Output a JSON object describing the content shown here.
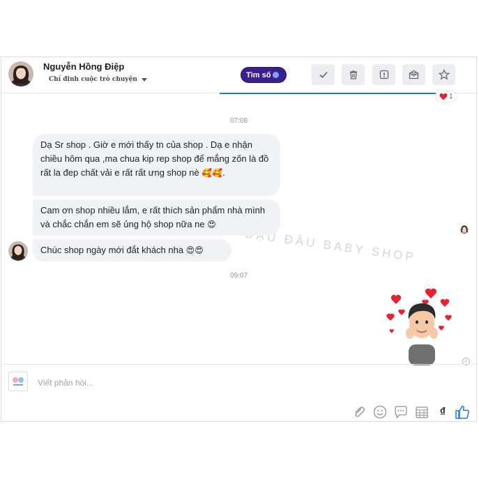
{
  "header": {
    "contact_name": "Nguyễn Hồng Điệp",
    "assign_label": "Chỉ định cuộc trò chuyện",
    "find_button": "Tìm số",
    "tools": [
      {
        "icon": "check-icon"
      },
      {
        "icon": "trash-icon"
      },
      {
        "icon": "report-icon"
      },
      {
        "icon": "mark-unread-icon"
      },
      {
        "icon": "star-icon"
      }
    ],
    "reaction_count": "1"
  },
  "conversation": {
    "time1": "07:08",
    "messages": [
      {
        "text": "Dạ Sr shop . Giờ e mới thấy tn của shop . Dạ e nhận chiều hôm qua ,ma chua kip rep shop để mắng zốn là đồ rất la đep chất vải e rất rất ưng shop nè",
        "emoji": "🥰🥰."
      },
      {
        "text": "Cam ơn shop nhiều lắm, e rất thích sản phẩm nhà mình và chắc chắn em sẽ ủng hộ shop nữa ne",
        "emoji": "😍"
      },
      {
        "text": "Chúc shop ngày mới đắt khách nha",
        "emoji": "😍😍"
      }
    ],
    "time2": "09:07",
    "watermark": "ĐẬU ĐẬU BABY SHOP ĐẬU ĐẬU BABY SHOP"
  },
  "composer": {
    "placeholder": "Viết phản hồi...",
    "icons": [
      "attachment-icon",
      "emoji-icon",
      "quick-reply-icon",
      "calendar-icon",
      "currency-icon",
      "like-icon"
    ],
    "currency_symbol": "₫"
  },
  "colors": {
    "accent": "#1877f2",
    "find_button_bg": "#3b1f8f",
    "bubble_bg": "#f0f2f5"
  }
}
